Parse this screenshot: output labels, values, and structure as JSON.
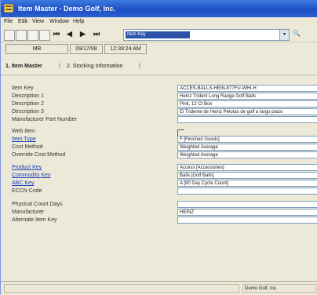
{
  "window": {
    "title": "Item Master - Demo Golf, Inc."
  },
  "menu": [
    "File",
    "Edit",
    "View",
    "Window",
    "Help"
  ],
  "toolbar": {
    "item_key_value": "Item Key",
    "dropdown_arrow": "▾",
    "search_glyph": "🔍",
    "nav_glyphs": [
      "⏮",
      "◀",
      "▶",
      "⏭"
    ]
  },
  "info": {
    "user": "MB",
    "date": "09/17/08",
    "time": "12:39:24 AM"
  },
  "tabs": [
    {
      "label": "1. Item Master"
    },
    {
      "label": "2. Stocking Information"
    }
  ],
  "fields": {
    "item_key": {
      "label": "Item Key",
      "value": "ACCES-BALLS-HEIN-877FU-WHI-H"
    },
    "description_1": {
      "label": "Description 1",
      "value": "Heinz Trident Long Range Golf Balls"
    },
    "description_2": {
      "label": "Description 2",
      "value": "Pink, 12 Ct Box"
    },
    "description_3": {
      "label": "Description 3",
      "value": "El Tridente de Heinz Pelotas de golf a largo plazo"
    },
    "mfr_part_number": {
      "label": "Manufacturer Part Number",
      "value": ""
    },
    "web_item": {
      "label": "Web Item"
    },
    "item_type": {
      "label": "Item Type",
      "value": "F    [Finished Goods]"
    },
    "cost_method": {
      "label": "Cost Method",
      "value": "Weighted Average"
    },
    "override_cost": {
      "label": "Override Cost Method",
      "value": "Weighted Average"
    },
    "product_key": {
      "label": "Product Key",
      "value": "Access    [Accessories]"
    },
    "commodity_key": {
      "label": "Commodity Key",
      "value": "Balls    [Golf Balls]"
    },
    "abc_key": {
      "label": "ABC Key",
      "value": "A [90 Day Cycle Count]"
    },
    "eccn_code": {
      "label": "ECCN Code",
      "value": ""
    },
    "physical_count": {
      "label": "Physical Count Days",
      "value": ""
    },
    "manufacturer": {
      "label": "Manufacturer",
      "value": "HEINZ"
    },
    "alternate_key": {
      "label": "Alternate Item Key",
      "value": ""
    }
  },
  "status": {
    "company": "Demo Golf, Inc."
  }
}
